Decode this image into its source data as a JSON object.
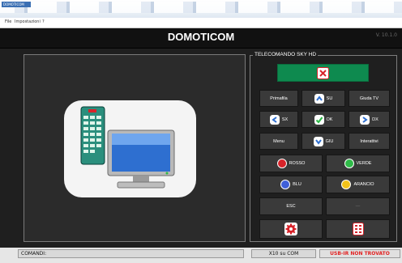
{
  "window": {
    "app_badge": "DOMOTICOM",
    "menu": [
      "File",
      "Impostazioni",
      "?"
    ]
  },
  "header": {
    "title": "DOMOTICOM",
    "version": "V. 10.1.0"
  },
  "remote": {
    "legend": "TELECOMANDO SKY HD",
    "buttons": {
      "power": "power-icon",
      "primafila": "Primafila",
      "su": "SU",
      "guida_tv": "Giuda TV",
      "sx": "SX",
      "ok": "OK",
      "dx": "DX",
      "menu": "Menu",
      "giu": "GIU",
      "interattivi": "Interattivi",
      "rosso": "ROSSO",
      "verde": "VERDE",
      "blu": "BLU",
      "arancio": "ARANCIO",
      "esc": "ESC",
      "empty": "—"
    }
  },
  "status": {
    "comandi_label": "COMANDI:",
    "x10": "X10 su COM",
    "usb": "USB-IR NON TROVATO"
  },
  "colors": {
    "accent_green": "#0e8a4f",
    "red": "#d8232a",
    "green": "#2fba48",
    "blue": "#3f5fd8",
    "orange": "#f2c21a",
    "status_error": "#e21f1f"
  }
}
